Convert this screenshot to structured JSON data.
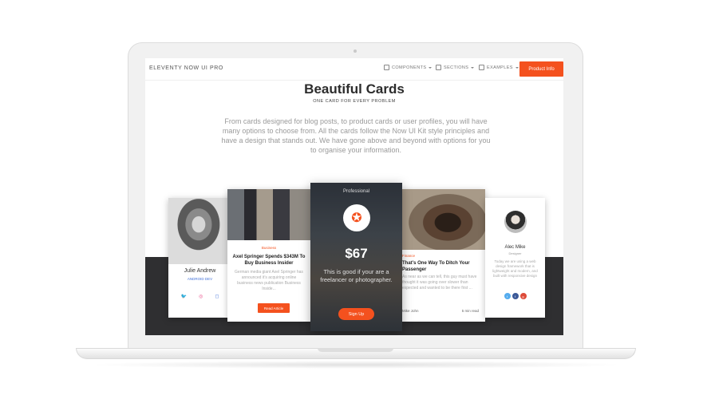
{
  "navbar": {
    "brand": "ELEVENTY NOW UI PRO",
    "items": [
      {
        "label": "COMPONENTS",
        "icon": "box-icon"
      },
      {
        "label": "SECTIONS",
        "icon": "layers-icon"
      },
      {
        "label": "EXAMPLES",
        "icon": "image-icon"
      }
    ],
    "cta": "Product Info"
  },
  "header": {
    "title": "Beautiful Cards",
    "subtitle": "ONE CARD FOR EVERY PROBLEM",
    "description": "From cards designed for blog posts, to product cards or user profiles, you will have many options to choose from. All the cards follow the Now UI Kit style principles and have a design that stands out. We have gone above and beyond with options for you to organise your information."
  },
  "cards": {
    "profile": {
      "name": "Julie Andrew",
      "role": "ANDROID DEV",
      "social": [
        "twitter",
        "dribbble",
        "instagram"
      ]
    },
    "blog": {
      "tag": "Business",
      "title": "Axel Springer Spends $343M To Buy Business Insider",
      "text": "German media giant Axel Springer has announced it’s acquiring online business news publication Business Inside...",
      "button": "Read Article"
    },
    "pricing": {
      "label": "Professional",
      "price": "$67",
      "text": "This is good if your are a freelancer or photographer.",
      "button": "Sign Up"
    },
    "blog2": {
      "tag": "Finance",
      "title": "That’s One Way To Ditch Your Passenger",
      "text": "As near as we can tell, this guy must have thought it was going over slower than expected and wanted to be there first ...",
      "author": "Mike John",
      "time": "5 min read"
    },
    "team": {
      "name": "Alec Mike",
      "role": "Designer",
      "text": "Today we are using a web design framework that is lightweight and modern, and built with responsive design",
      "social": [
        "tw",
        "fb",
        "gp"
      ]
    }
  },
  "colors": {
    "accent": "#f4511e",
    "dark_band": "#2f2f31"
  }
}
